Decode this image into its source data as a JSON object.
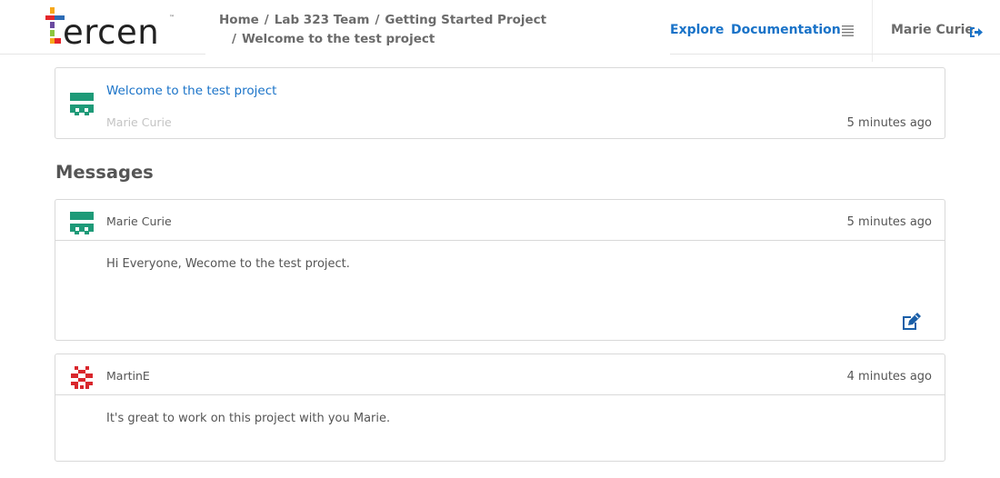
{
  "app": {
    "logo_text": "ercen",
    "logo_tm": "™"
  },
  "breadcrumb": {
    "home": "Home",
    "team": "Lab 323 Team",
    "project": "Getting Started Project",
    "current": "Welcome to the test project",
    "separator": "/"
  },
  "nav": {
    "explore": "Explore",
    "documentation": "Documentation",
    "user": "Marie Curie"
  },
  "project_card": {
    "title": "Welcome to the test project",
    "author": "Marie Curie",
    "time": "5 minutes ago"
  },
  "messages": {
    "heading": "Messages",
    "items": [
      {
        "author": "Marie Curie",
        "time": "5 minutes ago",
        "body": "Hi Everyone, Wecome to the test project."
      },
      {
        "author": "MartinE",
        "time": "4 minutes ago",
        "body": "It's great to work on this project with you Marie."
      }
    ]
  },
  "colors": {
    "link_blue": "#1a73c8",
    "avatar_green": "#1e9a78",
    "avatar_red": "#d9262c",
    "edit_icon_blue": "#1a5fa8"
  },
  "icons": {
    "menu": "hamburger-menu-icon",
    "logout": "sign-out-icon",
    "edit": "edit-pencil-icon",
    "avatar_marie": "identicon-green",
    "avatar_martin": "identicon-red"
  }
}
